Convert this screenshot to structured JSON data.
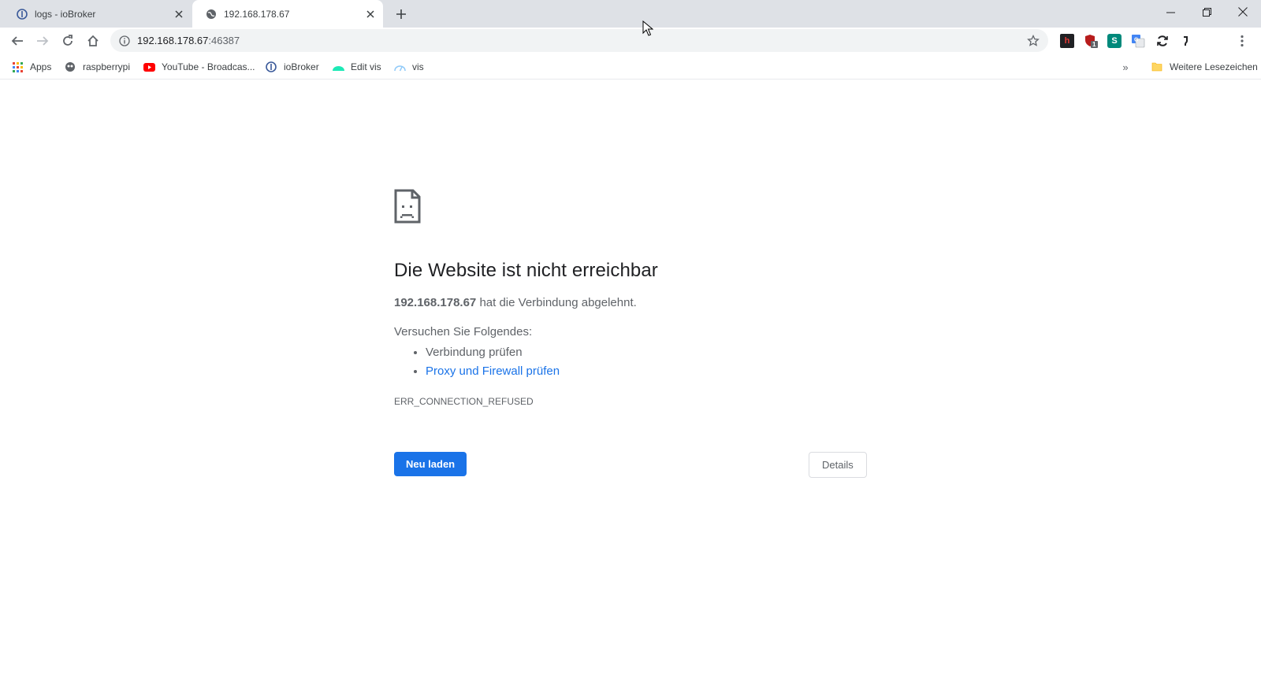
{
  "tabs": [
    {
      "title": "logs - ioBroker",
      "icon": "iobroker-icon",
      "active": false
    },
    {
      "title": "192.168.178.67",
      "icon": "globe-icon",
      "active": true
    }
  ],
  "omnibox": {
    "host": "192.168.178.67",
    "port": ":46387"
  },
  "bookmarks": {
    "items": [
      {
        "label": "Apps",
        "icon": "apps-grid-icon"
      },
      {
        "label": "raspberrypi",
        "icon": "raspberrypi-icon"
      },
      {
        "label": "YouTube - Broadcas...",
        "icon": "youtube-icon"
      },
      {
        "label": "ioBroker",
        "icon": "iobroker-icon"
      },
      {
        "label": "Edit vis",
        "icon": "vis-edit-icon"
      },
      {
        "label": "vis",
        "icon": "vis-icon"
      }
    ],
    "overflow": "»",
    "other": "Weitere Lesezeichen"
  },
  "extensions": {
    "badge": "1"
  },
  "error": {
    "title": "Die Website ist nicht erreichbar",
    "host": "192.168.178.67",
    "message": " hat die Verbindung abgelehnt.",
    "try_heading": "Versuchen Sie Folgendes:",
    "suggestions": [
      "Verbindung prüfen",
      "Proxy und Firewall prüfen"
    ],
    "code": "ERR_CONNECTION_REFUSED",
    "reload_label": "Neu laden",
    "details_label": "Details"
  },
  "colors": {
    "accent": "#1a73e8",
    "tabstrip": "#dee1e6",
    "text_secondary": "#5f6368"
  }
}
